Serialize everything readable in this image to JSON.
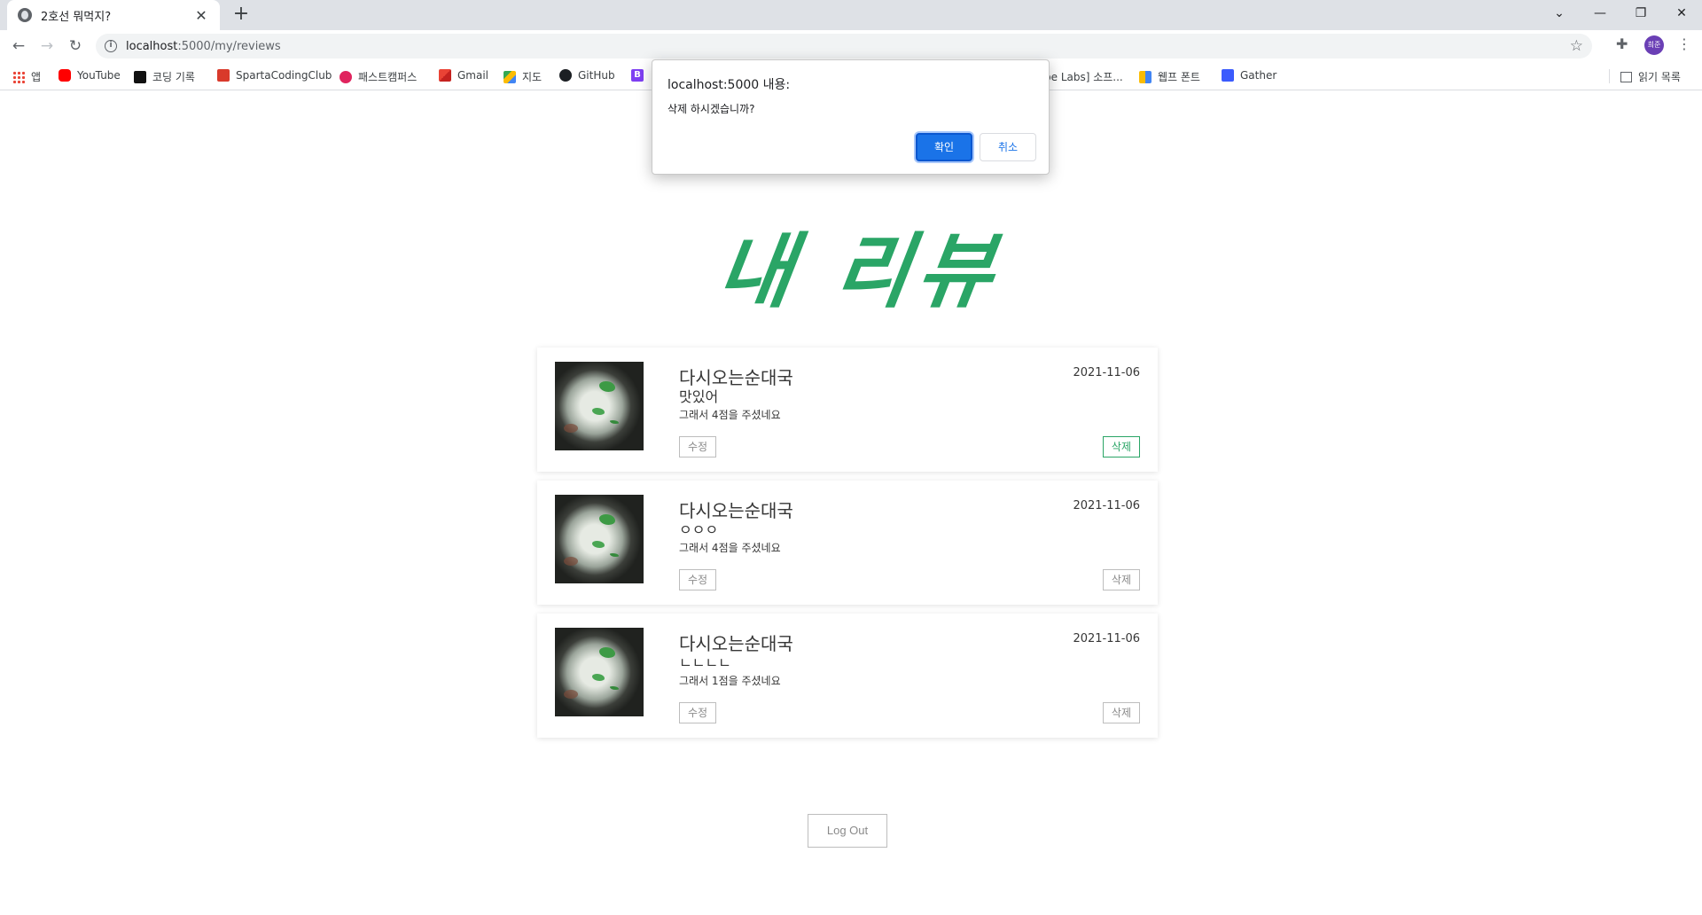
{
  "browser": {
    "tab_title": "2호선 뭐먹지?",
    "url_host": "localhost",
    "url_path": ":5000/my/reviews",
    "profile_initials": "희준",
    "bookmarks": [
      "앱",
      "YouTube",
      "코딩 기록",
      "SpartaCodingClub",
      "패스트캠퍼스",
      "Gmail",
      "지도",
      "GitHub",
      "B",
      "be Labs] 소프...",
      "웹프 폰트",
      "Gather"
    ],
    "reading_list": "읽기 목록"
  },
  "dialog": {
    "title": "localhost:5000 내용:",
    "message": "삭제 하시겠습니까?",
    "ok_label": "확인",
    "cancel_label": "취소"
  },
  "page": {
    "title": "내 리뷰",
    "accent_color": "#2aa566",
    "reviews": [
      {
        "store": "다시오는순대국",
        "comment": "맛있어",
        "score_text": "그래서 4점을 주셨네요",
        "date": "2021-11-06",
        "edit_label": "수정",
        "delete_label": "삭제"
      },
      {
        "store": "다시오는순대국",
        "comment": "ㅇㅇㅇ",
        "score_text": "그래서 4점을 주셨네요",
        "date": "2021-11-06",
        "edit_label": "수정",
        "delete_label": "삭제"
      },
      {
        "store": "다시오는순대국",
        "comment": "ㄴㄴㄴㄴ",
        "score_text": "그래서 1점을 주셨네요",
        "date": "2021-11-06",
        "edit_label": "수정",
        "delete_label": "삭제"
      }
    ],
    "logout_label": "Log Out"
  }
}
